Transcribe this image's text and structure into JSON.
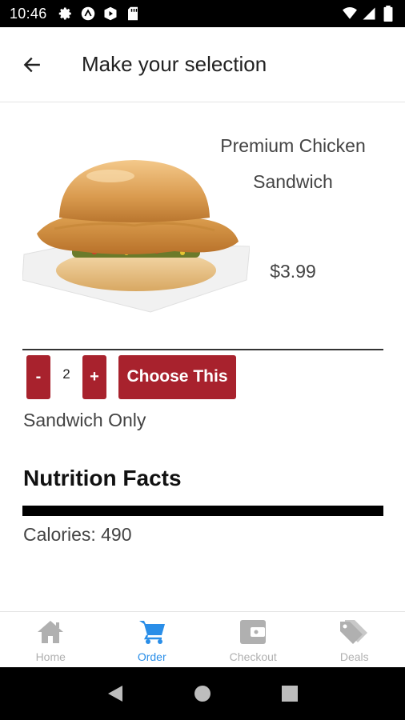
{
  "status_bar": {
    "time": "10:46",
    "left_icons": [
      "settings-icon",
      "app-icon",
      "play-icon",
      "sd-card-icon"
    ],
    "right_icons": [
      "wifi-icon",
      "signal-icon",
      "battery-icon"
    ]
  },
  "app_bar": {
    "back_icon": "arrow-left-icon",
    "title": "Make your selection"
  },
  "product": {
    "name": "Premium Chicken Sandwich",
    "price": "$3.99",
    "image": "chicken-sandwich"
  },
  "quantity": {
    "decrement_label": "-",
    "value": "2",
    "increment_label": "+"
  },
  "choose_button": "Choose This",
  "option_label": "Sandwich Only",
  "nutrition": {
    "heading": "Nutrition Facts",
    "calories": "Calories: 490"
  },
  "bottom_nav": {
    "items": [
      {
        "label": "Home",
        "icon": "home-icon",
        "active": false
      },
      {
        "label": "Order",
        "icon": "cart-icon",
        "active": true
      },
      {
        "label": "Checkout",
        "icon": "wallet-icon",
        "active": false
      },
      {
        "label": "Deals",
        "icon": "tags-icon",
        "active": false
      }
    ]
  },
  "colors": {
    "accent_red": "#a8222d",
    "active_blue": "#2a8ee8",
    "inactive_gray": "#b0b0b0"
  },
  "system_nav": [
    "back-triangle-icon",
    "home-circle-icon",
    "recents-square-icon"
  ]
}
